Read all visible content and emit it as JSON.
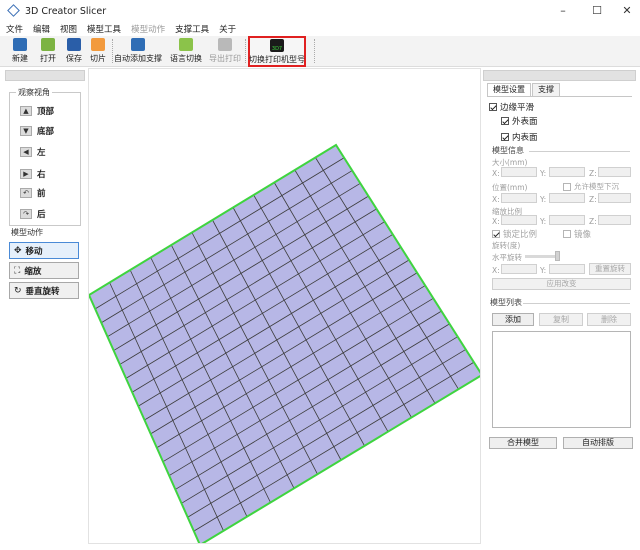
{
  "window": {
    "title": "3D Creator Slicer",
    "min_glyph": "–",
    "max_glyph": "☐",
    "close_glyph": "✕"
  },
  "menu": [
    "文件",
    "编辑",
    "视图",
    "模型工具",
    "模型动作",
    "支撑工具",
    "关于"
  ],
  "toolbar": [
    {
      "label": "新建",
      "icon": "new-file-icon",
      "color": "#2f6db5",
      "enabled": true
    },
    {
      "label": "打开",
      "icon": "open-icon",
      "color": "#7cb342",
      "enabled": true
    },
    {
      "label": "保存",
      "icon": "save-icon",
      "color": "#2a5ea8",
      "enabled": true
    },
    {
      "label": "切片",
      "icon": "slice-icon",
      "color": "#f29a3d",
      "enabled": true
    },
    {
      "label": "自动添加支撑",
      "icon": "auto-support-icon",
      "color": "#2f6db5",
      "enabled": true
    },
    {
      "label": "语言切换",
      "icon": "language-icon",
      "color": "#8bc34a",
      "enabled": true
    },
    {
      "label": "导出打印",
      "icon": "export-print-icon",
      "color": "#b9b9b9",
      "enabled": false
    },
    {
      "label": "切换打印机型号",
      "icon": "printer-model-icon",
      "color": "#1a1a1a",
      "enabled": true,
      "active": true,
      "badge": "3D7"
    }
  ],
  "left_panel": {
    "view_group_title": "观察视角",
    "views": [
      {
        "label": "顶部",
        "icon": "top-view-icon",
        "glyph": "▲"
      },
      {
        "label": "底部",
        "icon": "bottom-view-icon",
        "glyph": "▼"
      },
      {
        "label": "左",
        "icon": "left-view-icon",
        "glyph": "◀"
      },
      {
        "label": "右",
        "icon": "right-view-icon",
        "glyph": "▶"
      },
      {
        "label": "前",
        "icon": "front-view-icon",
        "glyph": "↶"
      },
      {
        "label": "后",
        "icon": "back-view-icon",
        "glyph": "↷"
      }
    ],
    "action_group_title": "模型动作",
    "actions": [
      {
        "label": "移动",
        "icon": "move-icon",
        "glyph": "✥",
        "selected": true
      },
      {
        "label": "缩放",
        "icon": "scale-icon",
        "glyph": "⛶",
        "selected": false
      },
      {
        "label": "垂直旋转",
        "icon": "rotate-icon",
        "glyph": "↻",
        "selected": false
      }
    ]
  },
  "right_panel": {
    "tabs": [
      "模型设置",
      "支撑"
    ],
    "smooth_edges": "边缘平滑",
    "outer_surface": "外表面",
    "inner_surface": "内表面",
    "model_info": "模型信息",
    "size_label": "大小(mm)",
    "position_label": "位置(mm)",
    "allow_sink": "允许模型下沉",
    "scale_label": "缩放比例",
    "lock_ratio": "锁定比例",
    "mirror": "镜像",
    "rotation_label": "旋转(度)",
    "horizontal_rotation": "水平旋转",
    "reset_rotation": "重置旋转",
    "apply_changes": "应用改变",
    "axis_x": "X:",
    "axis_y": "Y:",
    "axis_z": "Z:",
    "model_list": "模型列表",
    "add": "添加",
    "copy": "复制",
    "delete": "删除",
    "merge": "合并模型",
    "auto_arrange": "自动排版"
  },
  "colors": {
    "plate_fill": "#b7b7e6",
    "grid_line": "#3c3c3c",
    "plate_edge": "#3fd43f",
    "active_border": "#e02020"
  }
}
